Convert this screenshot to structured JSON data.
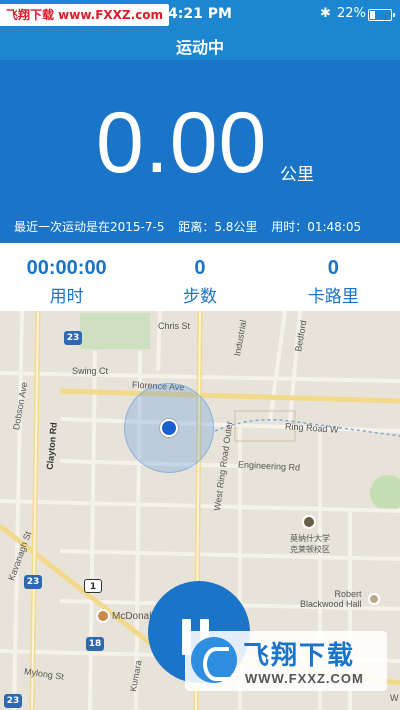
{
  "status_bar": {
    "watermark_text": "飞翔下载 www.FXXZ.com",
    "time": "4:21 PM",
    "bluetooth_icon": "bluetooth-icon",
    "battery_percent": "22%",
    "battery_level": 0.22
  },
  "nav": {
    "title": "运动中"
  },
  "summary": {
    "distance": "0.00",
    "distance_unit": "公里",
    "last_run": {
      "date_text": "最近一次运动是在2015-7-5",
      "distance_text": "距离：5.8公里",
      "duration_text": "用时：01:48:05"
    }
  },
  "stats": [
    {
      "value": "00:00:00",
      "label": "用时"
    },
    {
      "value": "0",
      "label": "步数"
    },
    {
      "value": "0",
      "label": "卡路里"
    }
  ],
  "map": {
    "labels": {
      "chris_st": "Chris St",
      "swing_ct": "Swing Ct",
      "florence_ave": "Florence Ave",
      "dobson_ave": "Dobson Ave",
      "clayton_rd": "Clayton Rd",
      "industrial": "Industrial",
      "bedford": "Bedford",
      "ring_road_w": "Ring Road W",
      "engineering_rd": "Engineering Rd",
      "west_ring_road_outer": "West Ring Road Outer",
      "university": "莫纳什大学\n克莱顿校区",
      "robert_blackwood_hall": "Robert\nBlackwood Hall",
      "kavanagh_st": "Kavanagh St",
      "mcdonalds": "McDonal",
      "kumara": "Kumara",
      "mylong_st": "Mylong St",
      "w": "W"
    },
    "shields": [
      "23",
      "23",
      "1",
      "18",
      "23"
    ]
  },
  "controls": {
    "pause_icon": "pause-icon"
  },
  "watermark": {
    "name": "飞翔下载",
    "url": "WWW.FXXZ.COM",
    "logo_icon": "fxxz-logo-icon"
  },
  "colors": {
    "primary": "#1a74c7",
    "header": "#1c86d0"
  }
}
